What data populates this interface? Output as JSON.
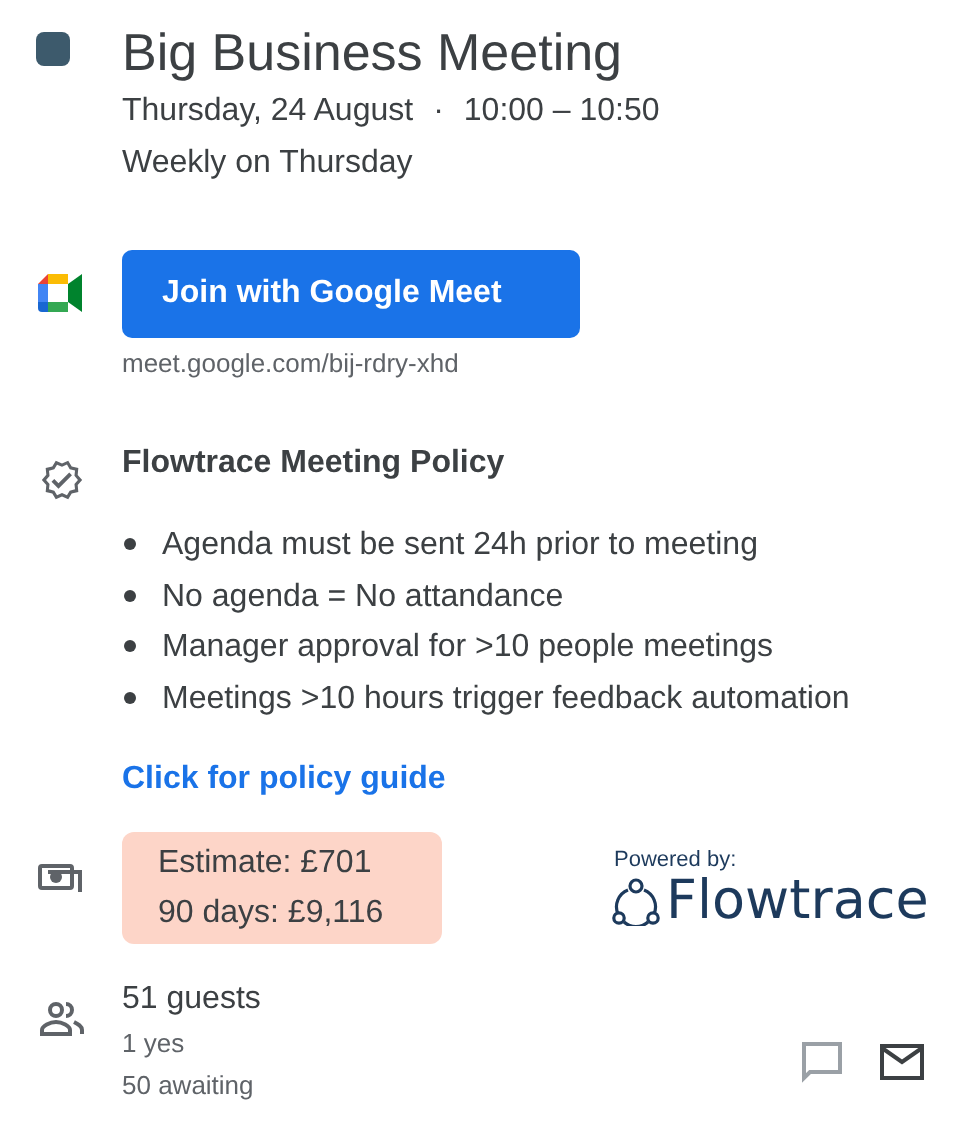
{
  "event": {
    "title": "Big Business Meeting",
    "date": "Thursday, 24 August",
    "separator": "·",
    "time": "10:00 – 10:50",
    "recurrence": "Weekly on Thursday"
  },
  "meet": {
    "button": "Join with Google Meet",
    "url": "meet.google.com/bij-rdry-xhd"
  },
  "policy": {
    "title": "Flowtrace Meeting Policy",
    "rules": [
      "Agenda must be sent 24h prior to meeting",
      "No agenda = No attandance",
      "Manager approval for >10 people meetings",
      "Meetings >10 hours trigger feedback automation"
    ],
    "link": "Click for policy guide"
  },
  "cost": {
    "lines": [
      "Estimate: £701",
      "90 days: £9,116"
    ],
    "powered_by": "Powered by:",
    "brand": "Flowtrace"
  },
  "guests": {
    "count": "51 guests",
    "details": [
      "1 yes",
      "50 awaiting"
    ],
    "actions": [
      {
        "kind": "chat",
        "disabled": true
      },
      {
        "kind": "email",
        "disabled": false
      }
    ]
  }
}
